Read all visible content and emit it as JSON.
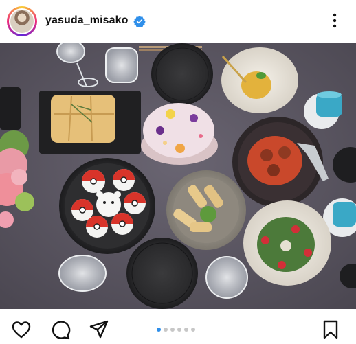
{
  "post": {
    "username": "yasuda_misako",
    "verified": true,
    "accent_color": "#2f8fea"
  },
  "icons": {
    "verified": "verified-badge-icon",
    "more": "more-options-icon",
    "like": "heart-icon",
    "comment": "comment-icon",
    "share": "send-icon",
    "save": "bookmark-icon"
  },
  "carousel": {
    "total": 6,
    "active_index": 0
  }
}
